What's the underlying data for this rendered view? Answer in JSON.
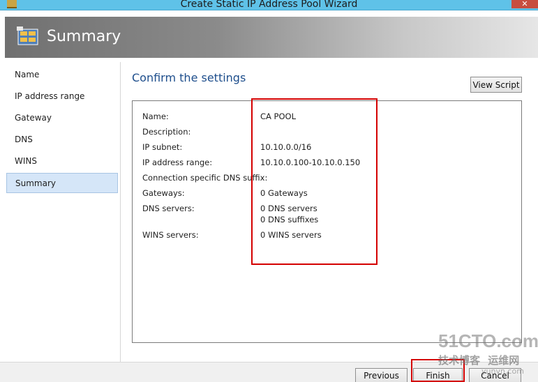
{
  "window": {
    "title": "Create Static IP Address Pool Wizard",
    "close_glyph": "✕"
  },
  "header": {
    "title": "Summary",
    "icon": "wizard-network-icon"
  },
  "nav": {
    "items": [
      {
        "label": "Name",
        "selected": false
      },
      {
        "label": "IP address range",
        "selected": false
      },
      {
        "label": "Gateway",
        "selected": false
      },
      {
        "label": "DNS",
        "selected": false
      },
      {
        "label": "WINS",
        "selected": false
      },
      {
        "label": "Summary",
        "selected": true
      }
    ]
  },
  "main": {
    "heading": "Confirm the settings",
    "view_script_label": "View Script",
    "settings": [
      {
        "label": "Name:",
        "value": "CA POOL"
      },
      {
        "label": "Description:",
        "value": ""
      },
      {
        "label": "IP subnet:",
        "value": "10.10.0.0/16"
      },
      {
        "label": "IP address range:",
        "value": "10.10.0.100-10.10.0.150"
      },
      {
        "label": "Connection specific DNS suffix:",
        "value": ""
      },
      {
        "label": "Gateways:",
        "value": "0 Gateways"
      },
      {
        "label": "DNS servers:",
        "value": "0 DNS servers",
        "value2": "0 DNS suffixes"
      },
      {
        "label": "WINS servers:",
        "value": "0 WINS servers"
      }
    ]
  },
  "footer": {
    "previous_label": "Previous",
    "finish_label": "Finish",
    "cancel_label": "Cancel"
  },
  "watermark": {
    "line1": "51CTO.com",
    "line2": "技术博客",
    "line3": "运维网",
    "line4": "yunvn.com"
  },
  "colors": {
    "title_bar": "#5fc2e8",
    "accent_heading": "#1e4e8c",
    "highlight": "#d40000",
    "nav_selected_bg": "#d5e6f8"
  }
}
